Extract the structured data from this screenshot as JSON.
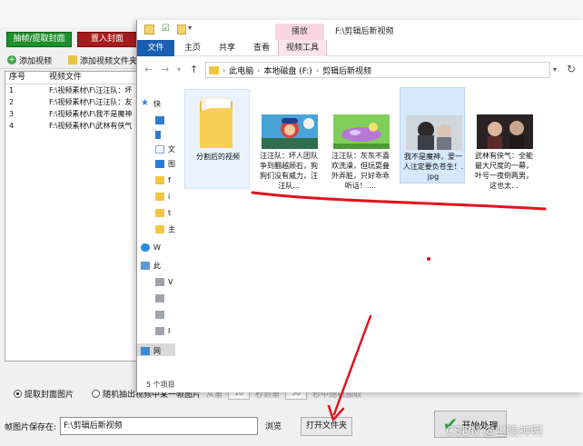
{
  "app": {
    "buttons": {
      "extract_cover": "抽帧/提取封面",
      "import_cover": "置入封面"
    },
    "toolbar": {
      "add_video": "添加视频",
      "add_video_folder": "添加视频文件夹"
    },
    "list": {
      "columns": [
        "序号",
        "视频文件"
      ],
      "rows": [
        {
          "no": "1",
          "file": "F:\\视频素材\\F\\汪汪队：坏"
        },
        {
          "no": "2",
          "file": "F:\\视频素材\\F\\汪汪队：友"
        },
        {
          "no": "3",
          "file": "F:\\视频素材\\F\\我不是魔神"
        },
        {
          "no": "4",
          "file": "F:\\视频素材\\F\\武林有侠气"
        }
      ]
    },
    "options": {
      "extract_cover_label": "提取封面图片",
      "random_label": "随机抽出视频中某一帧图片",
      "seconds_label": "从第",
      "seconds_value": "10",
      "to_label": "秒到第",
      "to_value": "30",
      "random_suffix": "秒中随机抽取"
    },
    "save": {
      "label": "帧图片保存在:",
      "path": "F:\\剪辑后新视频",
      "browse": "浏览",
      "open_folder": "打开文件夹",
      "start": "开始处理"
    },
    "watermark": "CSDN @尘隐神明"
  },
  "explorer": {
    "ribbon_context_tab": "播放",
    "window_title": "F:\\剪辑后新视频",
    "ribbon_tabs": [
      "文件",
      "主页",
      "共享",
      "查看",
      "视频工具"
    ],
    "breadcrumb": [
      "此电脑",
      "本地磁盘 (F:)",
      "剪辑后新视频"
    ],
    "nav_items": [
      {
        "label": "快",
        "icon": "star-icon"
      },
      {
        "label": "",
        "icon": "desktop-icon"
      },
      {
        "label": "",
        "icon": "download-icon"
      },
      {
        "label": "文",
        "icon": "document-icon"
      },
      {
        "label": "图",
        "icon": "pictures-icon"
      },
      {
        "label": "f",
        "icon": "folder-icon"
      },
      {
        "label": "i",
        "icon": "folder-icon"
      },
      {
        "label": "t",
        "icon": "folder-icon"
      },
      {
        "label": "主",
        "icon": "folder-icon"
      },
      {
        "label": "W",
        "icon": "cloud-icon"
      },
      {
        "label": "此",
        "icon": "computer-icon"
      },
      {
        "label": "V",
        "icon": "drive-icon"
      },
      {
        "label": "",
        "icon": "drive-icon"
      },
      {
        "label": "",
        "icon": "drive-icon"
      },
      {
        "label": "I",
        "icon": "drive-icon"
      },
      {
        "label": "网",
        "icon": "network-icon"
      }
    ],
    "items": [
      {
        "label": "分割后的视频",
        "kind": "folder"
      },
      {
        "label": "汪汪队：坏人团队争到翻越顾石，狗狗们没有威力，汪汪队...",
        "kind": "video"
      },
      {
        "label": "汪汪队：灰灰不喜欢洗澡，但玩耍叠外弄脏，只好乖乖听话！....",
        "kind": "video"
      },
      {
        "label": "我不是魔神，爱一人注定要负苍生！.jpg",
        "kind": "image"
      },
      {
        "label": "武林有侠气：全能最大尺度的一幕，叶号一夜倒两男，这也太...",
        "kind": "video"
      }
    ],
    "status": "5 个项目"
  }
}
